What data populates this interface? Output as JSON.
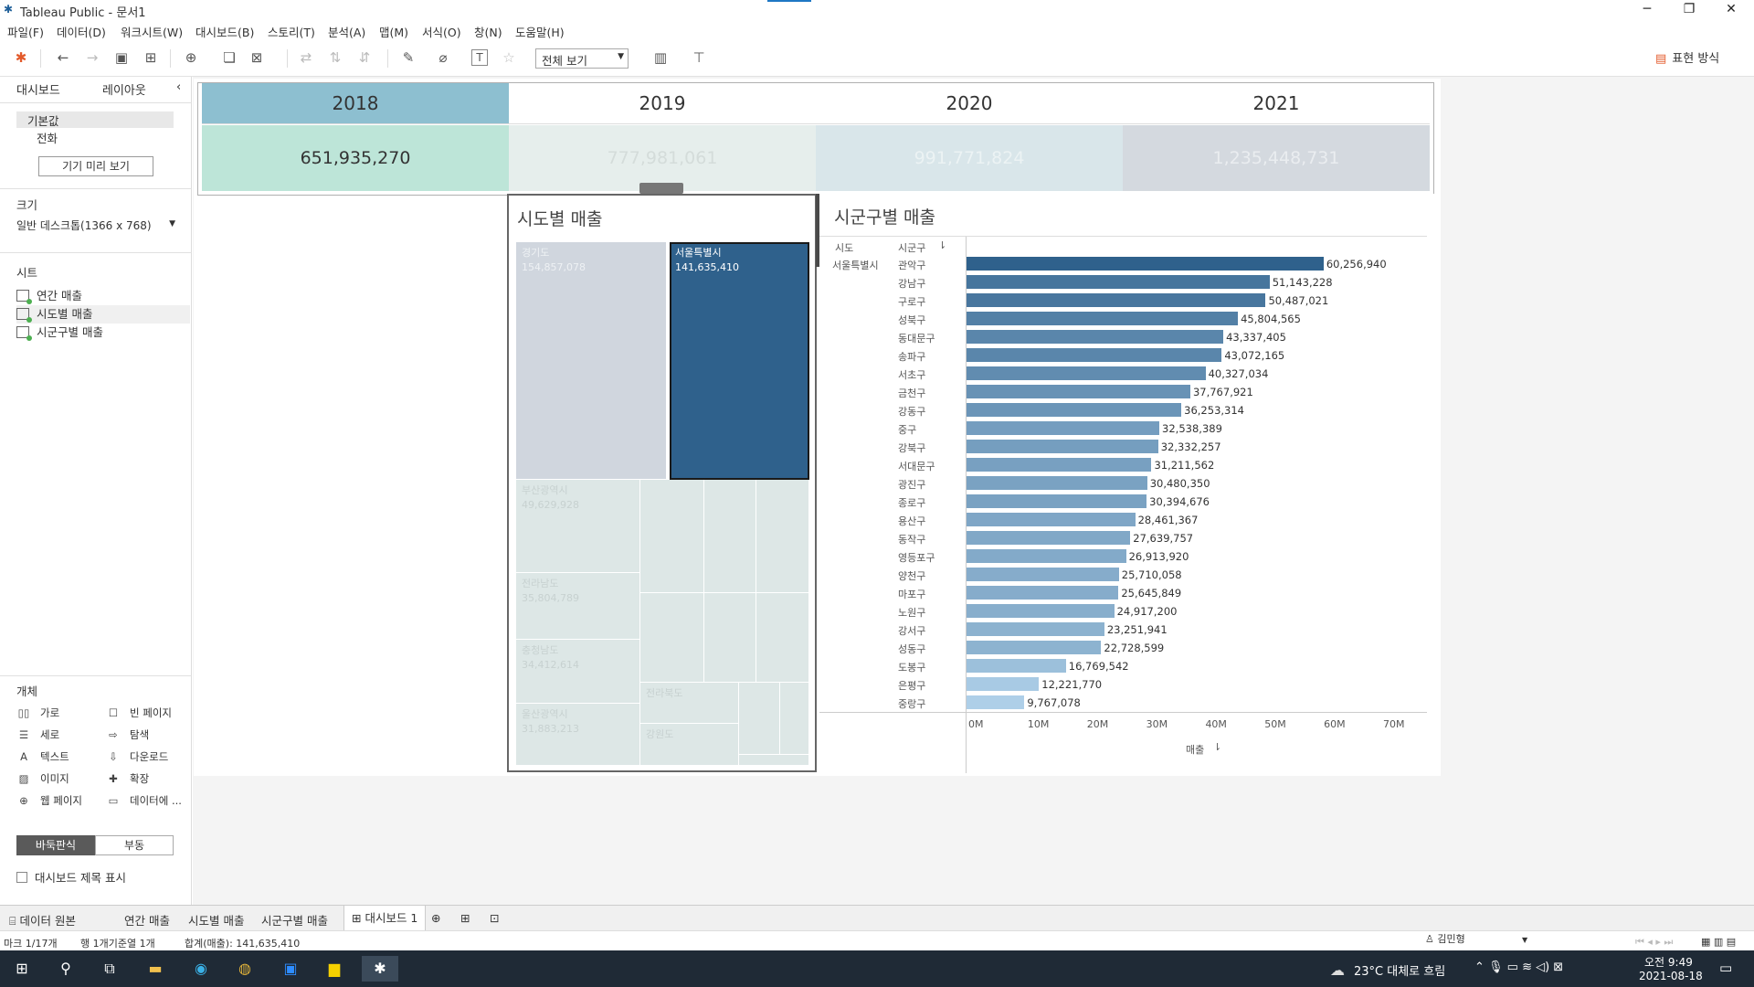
{
  "window": {
    "title": "Tableau Public - 문서1"
  },
  "menu": [
    "파일(F)",
    "데이터(D)",
    "워크시트(W)",
    "대시보드(B)",
    "스토리(T)",
    "분석(A)",
    "맵(M)",
    "서식(O)",
    "창(N)",
    "도움말(H)"
  ],
  "toolbar": {
    "view_select": "전체 보기",
    "show_me": "표현 방식"
  },
  "left_panel": {
    "tabs": [
      "대시보드",
      "레이아웃"
    ],
    "device_default": "기본값",
    "device_phone": "전화",
    "preview_button": "기기 미리 보기",
    "size_header": "크기",
    "size_value": "일반 데스크톱(1366 x 768)",
    "sheets_header": "시트",
    "sheets": [
      "연간 매출",
      "시도별 매출",
      "시군구별 매출"
    ],
    "objects_header": "개체",
    "objects": [
      {
        "label": "가로",
        "icon": "horizontal-icon"
      },
      {
        "label": "빈 페이지",
        "icon": "blank-icon"
      },
      {
        "label": "세로",
        "icon": "vertical-icon"
      },
      {
        "label": "탐색",
        "icon": "navigation-icon"
      },
      {
        "label": "텍스트",
        "icon": "text-icon"
      },
      {
        "label": "다운로드",
        "icon": "download-icon"
      },
      {
        "label": "이미지",
        "icon": "image-icon"
      },
      {
        "label": "확장",
        "icon": "extension-icon"
      },
      {
        "label": "웹 페이지",
        "icon": "web-page-icon"
      },
      {
        "label": "데이터에 ...",
        "icon": "data-story-icon"
      }
    ],
    "tiled": "바둑판식",
    "floating": "부동",
    "show_title": "대시보드 제목 표시"
  },
  "years": [
    {
      "year": "2018",
      "value": "651,935,270"
    },
    {
      "year": "2019",
      "value": "777,981,061"
    },
    {
      "year": "2020",
      "value": "991,771,824"
    },
    {
      "year": "2021",
      "value": "1,235,448,731"
    }
  ],
  "treemap": {
    "title": "시도별 매출",
    "cells": [
      {
        "name": "경기도",
        "value": "154,857,078"
      },
      {
        "name": "서울특별시",
        "value": "141,635,410"
      },
      {
        "name": "부산광역시",
        "value": "49,629,928"
      },
      {
        "name": "전라남도",
        "value": "35,804,789"
      },
      {
        "name": "충청남도",
        "value": "34,412,614"
      },
      {
        "name": "울산광역시",
        "value": "31,883,213"
      },
      {
        "name": "전라북도",
        "value": ""
      },
      {
        "name": "강원도",
        "value": ""
      }
    ]
  },
  "barchart": {
    "title": "시군구별 매출",
    "col_sido": "시도",
    "col_sigungu": "시군구",
    "sido_value": "서울특별시",
    "x_label": "매출"
  },
  "chart_data": {
    "type": "bar",
    "categories": [
      "관악구",
      "강남구",
      "구로구",
      "성북구",
      "동대문구",
      "송파구",
      "서초구",
      "금천구",
      "강동구",
      "중구",
      "강북구",
      "서대문구",
      "광진구",
      "종로구",
      "용산구",
      "동작구",
      "영등포구",
      "양천구",
      "마포구",
      "노원구",
      "강서구",
      "성동구",
      "도봉구",
      "은평구",
      "중랑구"
    ],
    "values": [
      60256940,
      51143228,
      50487021,
      45804565,
      43337405,
      43072165,
      40327034,
      37767921,
      36253314,
      32538389,
      32332257,
      31211562,
      30480350,
      30394676,
      28461367,
      27639757,
      26913920,
      25710058,
      25645849,
      24917200,
      23251941,
      22728599,
      16769542,
      12221770,
      9767078
    ],
    "labels": [
      "60,256,940",
      "51,143,228",
      "50,487,021",
      "45,804,565",
      "43,337,405",
      "43,072,165",
      "40,327,034",
      "37,767,921",
      "36,253,314",
      "32,538,389",
      "32,332,257",
      "31,211,562",
      "30,480,350",
      "30,394,676",
      "28,461,367",
      "27,639,757",
      "26,913,920",
      "25,710,058",
      "25,645,849",
      "24,917,200",
      "23,251,941",
      "22,728,599",
      "16,769,542",
      "12,221,770",
      "9,767,078"
    ],
    "x_ticks": [
      "0M",
      "10M",
      "20M",
      "30M",
      "40M",
      "50M",
      "60M",
      "70M"
    ],
    "xlim": [
      0,
      72000000
    ],
    "title": "시군구별 매출",
    "xlabel": "매출",
    "ylabel": "시군구"
  },
  "bottom_tabs": [
    "데이터 원본",
    "연간 매출",
    "시도별 매출",
    "시군구별 매출",
    "대시보드 1"
  ],
  "status": {
    "marks": "마크 1/17개",
    "rows": "행 1개기준열 1개",
    "sum": "합계(매출): 141,635,410",
    "user": "김민형"
  },
  "taskbar": {
    "weather": "23°C 대체로 흐림",
    "time": "오전 9:49",
    "date": "2021-08-18"
  }
}
